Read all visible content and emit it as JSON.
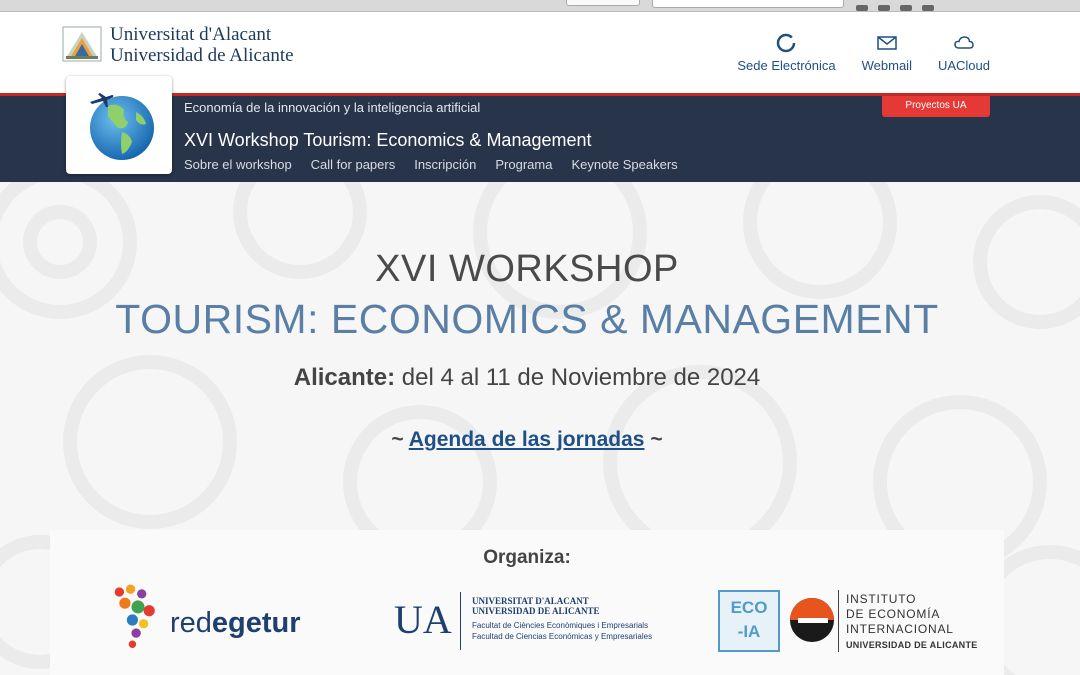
{
  "header": {
    "university_line1": "Universitat d'Alacant",
    "university_line2": "Universidad de Alicante",
    "links": [
      {
        "label": "Sede Electrónica",
        "icon": "circle-icon"
      },
      {
        "label": "Webmail",
        "icon": "mail-icon"
      },
      {
        "label": "UACloud",
        "icon": "cloud-icon"
      }
    ]
  },
  "band": {
    "subtitle": "Economía de la innovación y la inteligencia artificial",
    "site_title": "XVI Workshop Tourism: Economics & Management",
    "projects_button": "Proyectos UA",
    "nav": [
      "Sobre el workshop",
      "Call for papers",
      "Inscripción",
      "Programa",
      "Keynote Speakers"
    ]
  },
  "hero": {
    "title_line1": "XVI WORKSHOP",
    "title_line2": "TOURISM: ECONOMICS & MANAGEMENT",
    "place_label": "Alicante:",
    "dates_text": " del 4 al 11 de Noviembre de 2024",
    "agenda_prefix": "~ ",
    "agenda_link": "Agenda de las jornadas",
    "agenda_suffix": " ~"
  },
  "organiza": {
    "label": "Organiza:",
    "redegetur_prefix": "red",
    "redegetur_bold": "egetur",
    "ua_short": "UA",
    "ua_line1": "UNIVERSITAT D'ALACANT",
    "ua_line2": "UNIVERSIDAD DE ALICANTE",
    "ua_fac1": "Facultat de Ciències Econòmiques i Empresarials",
    "ua_fac2": "Facultad de Ciencias Económicas y Empresariales",
    "ecoia_line1": "ECO",
    "ecoia_line2": "-IA",
    "iei_line1": "INSTITUTO",
    "iei_line2": "DE ECONOMÍA",
    "iei_line3": "INTERNACIONAL",
    "iei_line4": "UNIVERSIDAD DE ALICANTE"
  },
  "colors": {
    "brand_navy": "#28344a",
    "accent_red": "#e53935",
    "title_blue": "#5a7fa6",
    "link_blue": "#1f4f87"
  }
}
